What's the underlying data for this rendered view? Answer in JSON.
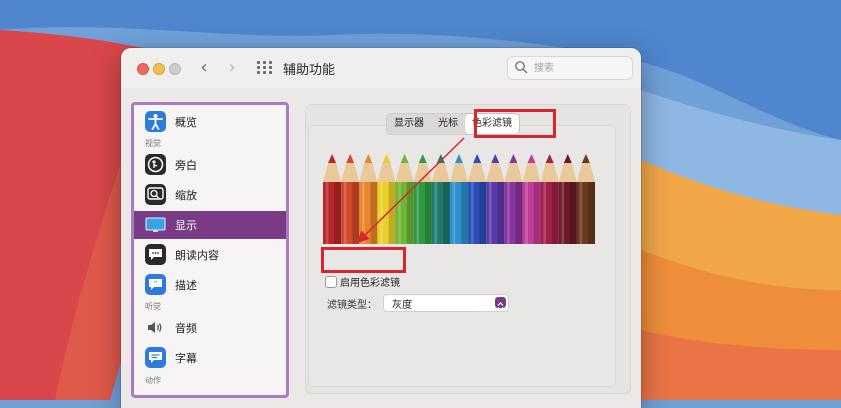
{
  "window": {
    "title": "辅助功能",
    "search_placeholder": "搜索"
  },
  "sidebar": {
    "sections": [
      "视觉",
      "听觉",
      "动作"
    ],
    "items": [
      {
        "label": "概览",
        "icon": "accessibility-icon"
      },
      {
        "label": "旁白",
        "icon": "voiceover-icon"
      },
      {
        "label": "缩放",
        "icon": "zoom-icon"
      },
      {
        "label": "显示",
        "icon": "display-icon"
      },
      {
        "label": "朗读内容",
        "icon": "spoken-content-icon"
      },
      {
        "label": "描述",
        "icon": "descriptions-icon"
      },
      {
        "label": "音频",
        "icon": "audio-icon"
      },
      {
        "label": "字幕",
        "icon": "captions-icon"
      }
    ],
    "selected": "显示"
  },
  "tabs": [
    "显示器",
    "光标",
    "色彩滤镜"
  ],
  "selected_tab": "色彩滤镜",
  "color_filter": {
    "enable_label": "启用色彩滤镜",
    "enabled": false,
    "type_label": "滤镜类型：",
    "type_value": "灰度"
  },
  "pencil_colors": [
    "#b8262a",
    "#d24a2b",
    "#e9862b",
    "#e9d12c",
    "#6fb536",
    "#2f9a46",
    "#1f7a6d",
    "#2f8fcf",
    "#2a4fb6",
    "#5a3aa8",
    "#8a34a0",
    "#c23c9a",
    "#a11f4a",
    "#6b1a28",
    "#6a3a1c"
  ],
  "accent_color": "#7a3b86",
  "annotation_color": "#d8262c"
}
